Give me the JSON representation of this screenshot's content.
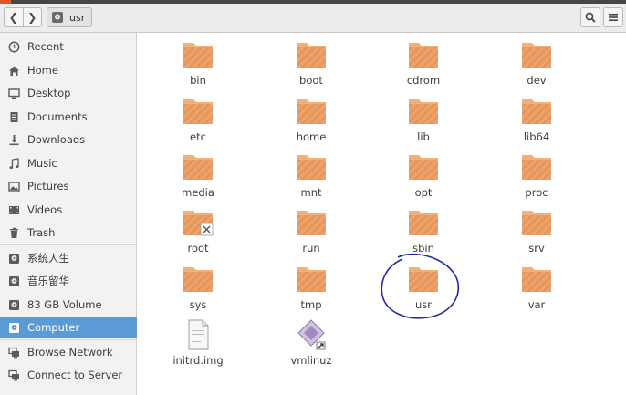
{
  "window": {
    "path_label": "usr"
  },
  "sidebar": {
    "items": [
      {
        "label": "Recent",
        "icon": "clock-icon"
      },
      {
        "label": "Home",
        "icon": "home-icon"
      },
      {
        "label": "Desktop",
        "icon": "desktop-icon"
      },
      {
        "label": "Documents",
        "icon": "document-icon"
      },
      {
        "label": "Downloads",
        "icon": "download-icon"
      },
      {
        "label": "Music",
        "icon": "music-icon"
      },
      {
        "label": "Pictures",
        "icon": "picture-icon"
      },
      {
        "label": "Videos",
        "icon": "video-icon"
      },
      {
        "label": "Trash",
        "icon": "trash-icon"
      },
      {
        "label": "系统人生",
        "icon": "drive-icon"
      },
      {
        "label": "音乐留华",
        "icon": "drive-icon"
      },
      {
        "label": "83 GB Volume",
        "icon": "drive-icon"
      },
      {
        "label": "Computer",
        "icon": "drive-icon",
        "active": true
      },
      {
        "label": "Browse Network",
        "icon": "network-icon"
      },
      {
        "label": "Connect to Server",
        "icon": "server-icon"
      }
    ]
  },
  "files": [
    {
      "name": "bin",
      "type": "folder"
    },
    {
      "name": "boot",
      "type": "folder"
    },
    {
      "name": "cdrom",
      "type": "folder"
    },
    {
      "name": "dev",
      "type": "folder"
    },
    {
      "name": "etc",
      "type": "folder"
    },
    {
      "name": "home",
      "type": "folder"
    },
    {
      "name": "lib",
      "type": "folder"
    },
    {
      "name": "lib64",
      "type": "folder"
    },
    {
      "name": "media",
      "type": "folder"
    },
    {
      "name": "mnt",
      "type": "folder"
    },
    {
      "name": "opt",
      "type": "folder"
    },
    {
      "name": "proc",
      "type": "folder"
    },
    {
      "name": "root",
      "type": "folder-locked"
    },
    {
      "name": "run",
      "type": "folder"
    },
    {
      "name": "sbin",
      "type": "folder"
    },
    {
      "name": "srv",
      "type": "folder"
    },
    {
      "name": "sys",
      "type": "folder"
    },
    {
      "name": "tmp",
      "type": "folder"
    },
    {
      "name": "usr",
      "type": "folder"
    },
    {
      "name": "var",
      "type": "folder"
    },
    {
      "name": "initrd.img",
      "type": "file"
    },
    {
      "name": "vmlinuz",
      "type": "file-link"
    }
  ],
  "colors": {
    "folder": "#e8955a",
    "folder_tab": "#f2b176",
    "selection": "#5b9bd5",
    "annotation": "#1f2aa8"
  }
}
